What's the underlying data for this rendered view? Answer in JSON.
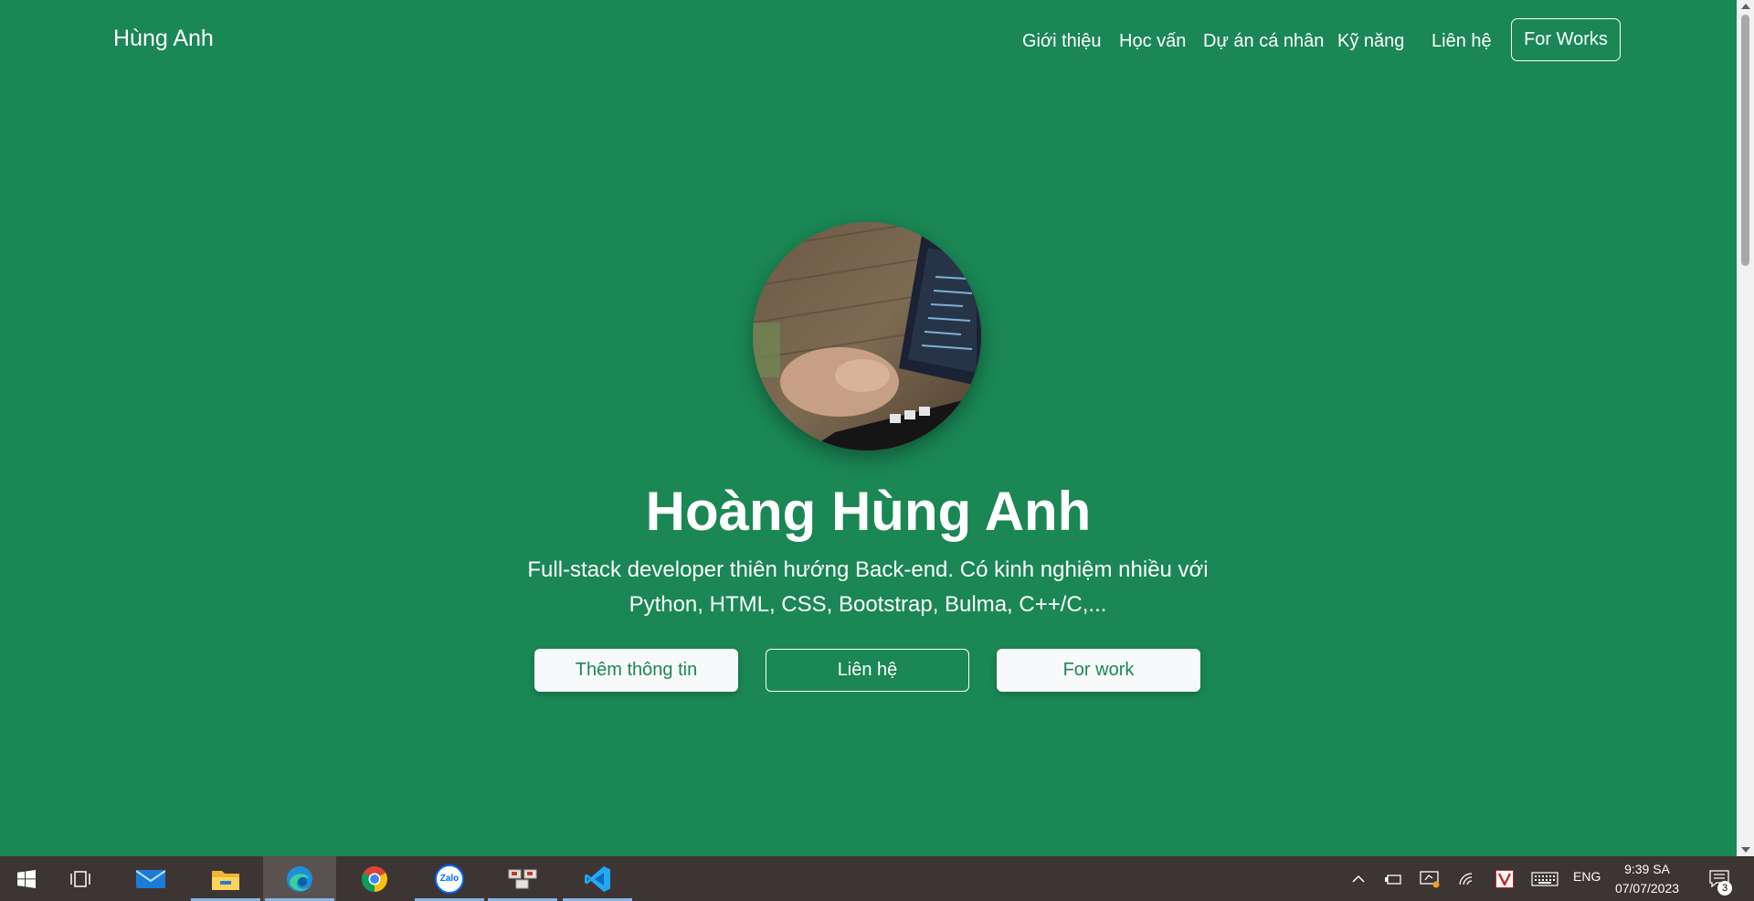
{
  "navbar": {
    "brand": "Hùng Anh",
    "links": [
      "Giới thiệu",
      "Học vấn",
      "Dự án cá nhân",
      "Kỹ năng",
      "Liên hệ"
    ],
    "cta": "For Works"
  },
  "hero": {
    "name": "Hoàng Hùng Anh",
    "subtitle_line1": "Full-stack developer thiên hướng Back-end. Có kinh nghiệm nhiều với",
    "subtitle_line2": "Python, HTML, CSS, Bootstrap, Bulma, C++/C,...",
    "buttons": [
      "Thêm thông tin",
      "Liên hệ",
      "For work"
    ]
  },
  "taskbar": {
    "apps": [
      "start-icon",
      "task-view-icon",
      "mail-icon",
      "file-explorer-icon",
      "edge-icon",
      "chrome-icon",
      "zalo-icon",
      "unikey-icon",
      "vscode-icon"
    ],
    "zalo_label": "Zalo",
    "language": "ENG",
    "time": "9:39 SA",
    "date": "07/07/2023",
    "notification_count": "3"
  },
  "colors": {
    "background": "#1a8754",
    "button_text": "#198754",
    "taskbar": "#3d3533"
  }
}
